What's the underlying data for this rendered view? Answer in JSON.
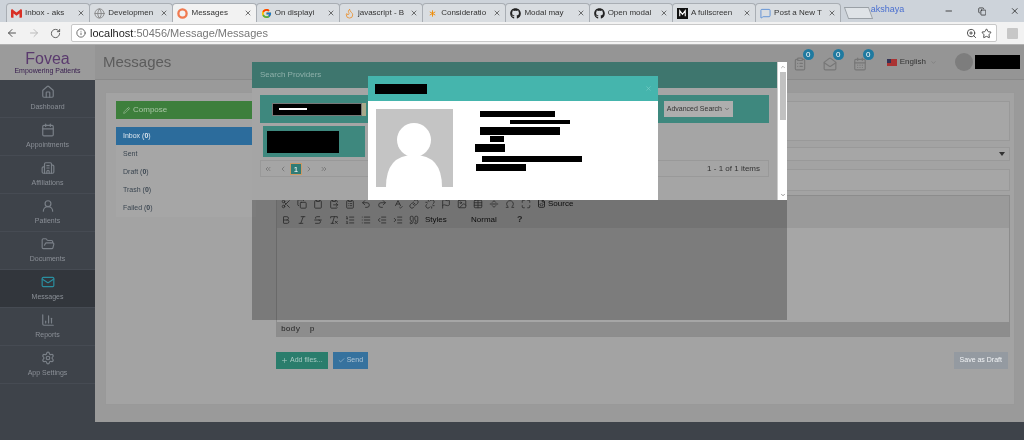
{
  "browser": {
    "tabs": [
      {
        "kind": "gmail",
        "title": "Inbox - aks",
        "selected": false
      },
      {
        "kind": "globe",
        "title": "Developmen",
        "selected": false
      },
      {
        "kind": "ring",
        "title": "Messages",
        "selected": true
      },
      {
        "kind": "google",
        "title": "On displayi",
        "selected": false
      },
      {
        "kind": "flame",
        "title": "javascript - B",
        "selected": false
      },
      {
        "kind": "asterisk",
        "title": "Consideratio",
        "selected": false
      },
      {
        "kind": "github",
        "title": "Modal may",
        "selected": false
      },
      {
        "kind": "github",
        "title": "Open modal",
        "selected": false
      },
      {
        "kind": "medium",
        "title": "A fullscreen",
        "selected": false
      },
      {
        "kind": "chat",
        "title": "Post a New T",
        "selected": false
      }
    ],
    "profile": "akshaya",
    "address": {
      "host": "localhost",
      "path": ":50456/Message/Messages"
    }
  },
  "app": {
    "logo": {
      "name": "Fovea",
      "tagline": "Empowering Patients"
    },
    "nav": [
      {
        "kind": "home",
        "label": "Dashboard",
        "selected": false
      },
      {
        "kind": "calendar",
        "label": "Appointments",
        "selected": false
      },
      {
        "kind": "building",
        "label": "Affiliations",
        "selected": false
      },
      {
        "kind": "patients",
        "label": "Patients",
        "selected": false
      },
      {
        "kind": "folder",
        "label": "Documents",
        "selected": false
      },
      {
        "kind": "mail",
        "label": "Messages",
        "selected": true
      },
      {
        "kind": "chart",
        "label": "Reports",
        "selected": false
      },
      {
        "kind": "gear",
        "label": "App Settings",
        "selected": false
      }
    ],
    "page_title": "Messages",
    "notifications": [
      {
        "kind": "tasks",
        "count": "0"
      },
      {
        "kind": "mail",
        "count": "0"
      },
      {
        "kind": "calendar",
        "count": "0"
      }
    ],
    "language": "English"
  },
  "mail": {
    "compose": "Compose",
    "folders": [
      {
        "label": "Inbox (**0**)",
        "selected": true
      },
      {
        "label": "Sent",
        "selected": false
      },
      {
        "label": "Draft  (**0**)",
        "selected": false
      },
      {
        "label": "Trash  (**0**)",
        "selected": false
      },
      {
        "label": "Failed (**0**)",
        "selected": false
      }
    ],
    "editor": {
      "styles": "Styles",
      "format": "Normal",
      "source": "Source",
      "help": "?",
      "path": "body  p"
    },
    "actions": {
      "add_files": "Add files...",
      "send": "Send",
      "save_draft": "Save as Draft"
    }
  },
  "search_modal": {
    "title": "Search Providers",
    "advanced": "Advanced Search",
    "pager": {
      "pages": [
        {
          "label": "1",
          "selected": true
        }
      ],
      "summary": "1 - 1 of 1 items"
    }
  }
}
